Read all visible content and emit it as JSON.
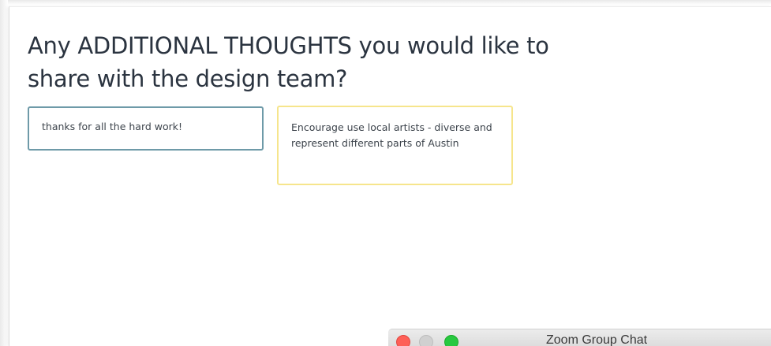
{
  "question": {
    "line1": "Any ADDITIONAL THOUGHTS you would like to",
    "line2": "share with the design team?"
  },
  "responses": [
    {
      "text": "thanks for all the hard work!",
      "border_color": "#6e9aa8"
    },
    {
      "text": "Encourage use local artists - diverse and represent different parts of Austin",
      "border_color": "#f6e58c"
    }
  ],
  "zoom_window": {
    "title": "Zoom Group Chat",
    "controls": {
      "close": {
        "icon": "close-traffic-light-icon",
        "color": "#fe5f57"
      },
      "minimize": {
        "icon": "minimize-traffic-light-icon",
        "color": "#d0d0d0"
      },
      "zoom": {
        "icon": "zoom-traffic-light-icon",
        "color": "#28c840"
      }
    }
  }
}
